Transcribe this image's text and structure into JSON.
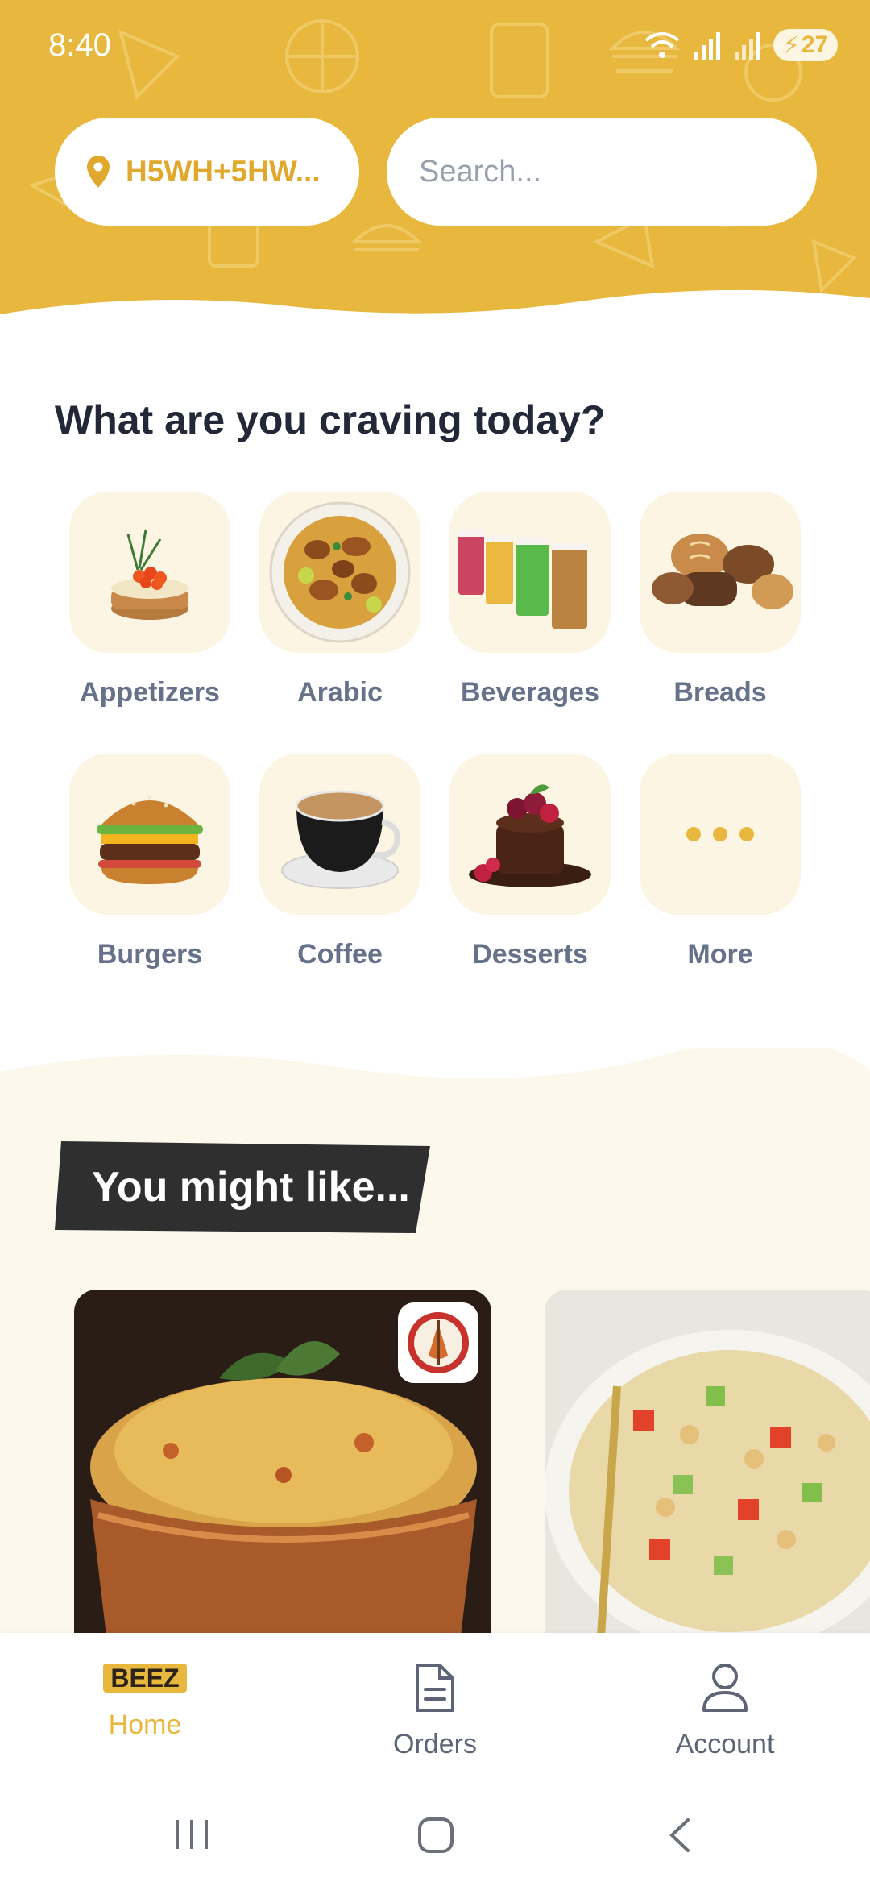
{
  "status_bar": {
    "time": "8:40",
    "battery": "27"
  },
  "header": {
    "location_label": "H5WH+5HW...",
    "search_placeholder": "Search..."
  },
  "categories_section": {
    "title": "What are you craving today?",
    "items": [
      {
        "label": "Appetizers"
      },
      {
        "label": "Arabic"
      },
      {
        "label": "Beverages"
      },
      {
        "label": "Breads"
      },
      {
        "label": "Burgers"
      },
      {
        "label": "Coffee"
      },
      {
        "label": "Desserts"
      },
      {
        "label": "More"
      }
    ]
  },
  "recommendations": {
    "title": "You might like..."
  },
  "bottom_nav": {
    "brand": "BEEZ",
    "items": [
      {
        "label": "Home"
      },
      {
        "label": "Orders"
      },
      {
        "label": "Account"
      }
    ]
  },
  "colors": {
    "accent": "#e8b83e",
    "tile_bg": "#fdf5e3",
    "banner": "#2f2f2f",
    "text_dark": "#232838",
    "text_muted": "#66718a"
  }
}
